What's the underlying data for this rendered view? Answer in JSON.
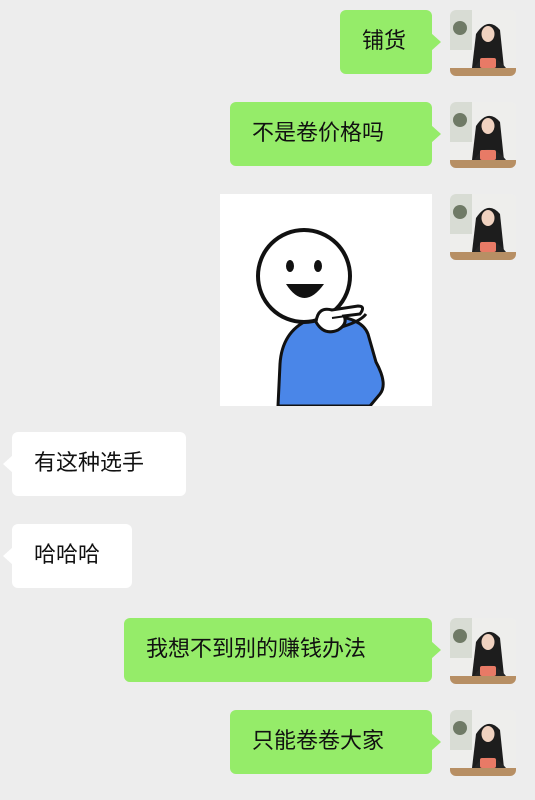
{
  "messages": [
    {
      "side": "me",
      "text": "铺货"
    },
    {
      "side": "me",
      "text": "不是卷价格吗"
    },
    {
      "side": "me",
      "type": "sticker",
      "sticker": "pointing-smiley-sticker"
    },
    {
      "side": "them",
      "text": "有这种选手"
    },
    {
      "side": "them",
      "text": "哈哈哈"
    },
    {
      "side": "me",
      "text": "我想不到别的赚钱办法"
    },
    {
      "side": "me",
      "text": "只能卷卷大家"
    }
  ],
  "colors": {
    "background": "#ededed",
    "my_bubble": "#95ec69",
    "their_bubble": "#ffffff",
    "sticker_shirt": "#4a86e8"
  }
}
